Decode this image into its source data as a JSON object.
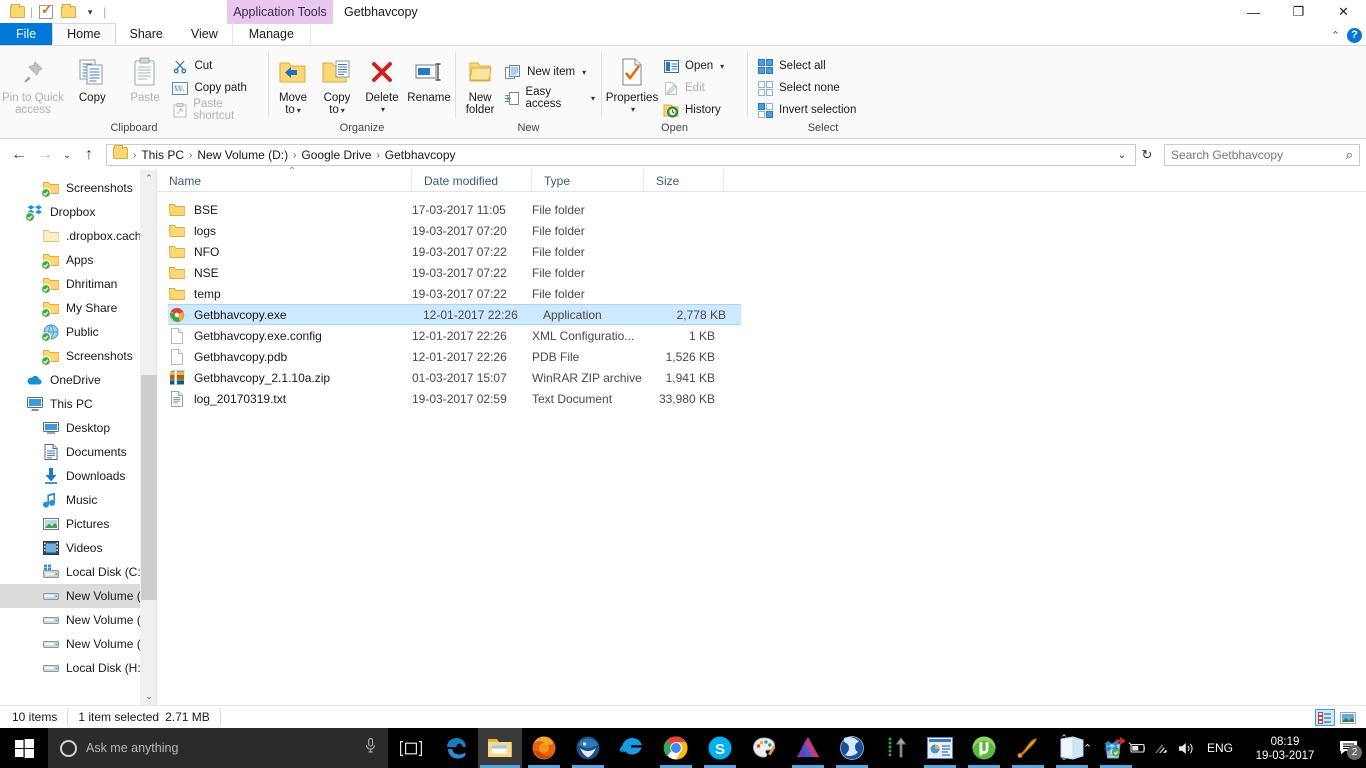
{
  "titlebar": {
    "app_tools_label": "Application Tools",
    "window_title": "Getbhavcopy",
    "minimize": "—",
    "maximize": "❐",
    "close": "✕"
  },
  "tabs": [
    {
      "label": "File",
      "type": "file"
    },
    {
      "label": "Home",
      "type": "active"
    },
    {
      "label": "Share",
      "type": "normal"
    },
    {
      "label": "View",
      "type": "normal"
    },
    {
      "label": "Manage",
      "type": "manage"
    }
  ],
  "ribbon": {
    "groups": [
      {
        "name": "Clipboard",
        "big": [
          {
            "label1": "Pin to Quick",
            "label2": "access",
            "icon": "pin-icon",
            "disabled": true
          },
          {
            "label1": "Copy",
            "label2": "",
            "icon": "copy-icon",
            "disabled": false
          },
          {
            "label1": "Paste",
            "label2": "",
            "icon": "paste-icon",
            "disabled": true
          }
        ],
        "small": [
          {
            "label": "Cut",
            "icon": "scissors-icon",
            "disabled": false
          },
          {
            "label": "Copy path",
            "icon": "copy-path-icon",
            "disabled": false
          },
          {
            "label": "Paste shortcut",
            "icon": "paste-shortcut-icon",
            "disabled": true
          }
        ]
      },
      {
        "name": "Organize",
        "big": [
          {
            "label1": "Move",
            "label2": "to",
            "icon": "move-to-icon",
            "caret": true
          },
          {
            "label1": "Copy",
            "label2": "to",
            "icon": "copy-to-icon",
            "caret": true
          },
          {
            "label1": "Delete",
            "label2": "",
            "icon": "delete-icon",
            "caret": true
          },
          {
            "label1": "Rename",
            "label2": "",
            "icon": "rename-icon",
            "caret": false
          }
        ]
      },
      {
        "name": "New",
        "big": [
          {
            "label1": "New",
            "label2": "folder",
            "icon": "new-folder-icon"
          }
        ],
        "small": [
          {
            "label": "New item",
            "icon": "new-item-icon",
            "caret": true
          },
          {
            "label": "Easy access",
            "icon": "easy-access-icon",
            "caret": true
          }
        ]
      },
      {
        "name": "Open",
        "big": [
          {
            "label1": "Properties",
            "label2": "",
            "icon": "properties-icon",
            "caret": true
          }
        ],
        "small": [
          {
            "label": "Open",
            "icon": "open-icon",
            "caret": true,
            "disabled": false
          },
          {
            "label": "Edit",
            "icon": "edit-icon",
            "disabled": true
          },
          {
            "label": "History",
            "icon": "history-icon",
            "disabled": false
          }
        ]
      },
      {
        "name": "Select",
        "small": [
          {
            "label": "Select all",
            "icon": "select-all-icon"
          },
          {
            "label": "Select none",
            "icon": "select-none-icon"
          },
          {
            "label": "Invert selection",
            "icon": "invert-selection-icon"
          }
        ]
      }
    ]
  },
  "addressbar": {
    "back": "←",
    "forward": "→",
    "recent": "⌄",
    "up": "↑",
    "breadcrumbs": [
      "This PC",
      "New Volume (D:)",
      "Google Drive",
      "Getbhavcopy"
    ],
    "dropdown": "⌄",
    "refresh": "↻",
    "search_placeholder": "Search Getbhavcopy",
    "search_value": "",
    "search_icon": "search-icon"
  },
  "navpane": {
    "items": [
      {
        "label": "Screenshots",
        "level": 1,
        "icon": "folder-sync-icon",
        "selected": false
      },
      {
        "label": "Dropbox",
        "level": 0,
        "icon": "dropbox-icon",
        "selected": false
      },
      {
        "label": ".dropbox.cache",
        "level": 1,
        "icon": "folder-plain-icon",
        "selected": false
      },
      {
        "label": "Apps",
        "level": 1,
        "icon": "folder-sync-icon",
        "selected": false
      },
      {
        "label": "Dhritiman",
        "level": 1,
        "icon": "folder-sync-icon",
        "selected": false
      },
      {
        "label": "My Share",
        "level": 1,
        "icon": "folder-sync-icon",
        "selected": false
      },
      {
        "label": "Public",
        "level": 1,
        "icon": "globe-sync-icon",
        "selected": false
      },
      {
        "label": "Screenshots",
        "level": 1,
        "icon": "folder-sync-icon",
        "selected": false
      },
      {
        "label": "OneDrive",
        "level": 0,
        "icon": "onedrive-icon",
        "selected": false
      },
      {
        "label": "This PC",
        "level": 0,
        "icon": "this-pc-icon",
        "selected": false
      },
      {
        "label": "Desktop",
        "level": 1,
        "icon": "desktop-icon",
        "selected": false
      },
      {
        "label": "Documents",
        "level": 1,
        "icon": "documents-icon",
        "selected": false
      },
      {
        "label": "Downloads",
        "level": 1,
        "icon": "downloads-icon",
        "selected": false
      },
      {
        "label": "Music",
        "level": 1,
        "icon": "music-icon",
        "selected": false
      },
      {
        "label": "Pictures",
        "level": 1,
        "icon": "pictures-icon",
        "selected": false
      },
      {
        "label": "Videos",
        "level": 1,
        "icon": "videos-icon",
        "selected": false
      },
      {
        "label": "Local Disk (C:)",
        "level": 1,
        "icon": "system-drive-icon",
        "selected": false
      },
      {
        "label": "New Volume (D:)",
        "level": 1,
        "icon": "drive-icon",
        "selected": true
      },
      {
        "label": "New Volume (F:)",
        "level": 1,
        "icon": "drive-icon",
        "selected": false
      },
      {
        "label": "New Volume (G:)",
        "level": 1,
        "icon": "drive-icon",
        "selected": false
      },
      {
        "label": "Local Disk (H:)",
        "level": 1,
        "icon": "drive-icon",
        "selected": false
      }
    ],
    "scroll_up": "⌃",
    "scroll_down": "⌄"
  },
  "filelist": {
    "columns": [
      {
        "label": "Name",
        "key": "name"
      },
      {
        "label": "Date modified",
        "key": "date"
      },
      {
        "label": "Type",
        "key": "type"
      },
      {
        "label": "Size",
        "key": "size"
      }
    ],
    "sort_indicator": "⌃",
    "rows": [
      {
        "name": "BSE",
        "date": "17-03-2017 11:05",
        "type": "File folder",
        "size": "",
        "icon": "folder-icon",
        "selected": false
      },
      {
        "name": "logs",
        "date": "19-03-2017 07:20",
        "type": "File folder",
        "size": "",
        "icon": "folder-icon",
        "selected": false
      },
      {
        "name": "NFO",
        "date": "19-03-2017 07:22",
        "type": "File folder",
        "size": "",
        "icon": "folder-icon",
        "selected": false
      },
      {
        "name": "NSE",
        "date": "19-03-2017 07:22",
        "type": "File folder",
        "size": "",
        "icon": "folder-icon",
        "selected": false
      },
      {
        "name": "temp",
        "date": "19-03-2017 07:22",
        "type": "File folder",
        "size": "",
        "icon": "folder-icon",
        "selected": false
      },
      {
        "name": "Getbhavcopy.exe",
        "date": "12-01-2017 22:26",
        "type": "Application",
        "size": "2,778 KB",
        "icon": "app-exe-icon",
        "selected": true
      },
      {
        "name": "Getbhavcopy.exe.config",
        "date": "12-01-2017 22:26",
        "type": "XML Configuratio...",
        "size": "1 KB",
        "icon": "blank-file-icon",
        "selected": false
      },
      {
        "name": "Getbhavcopy.pdb",
        "date": "12-01-2017 22:26",
        "type": "PDB File",
        "size": "1,526 KB",
        "icon": "blank-file-icon",
        "selected": false
      },
      {
        "name": "Getbhavcopy_2.1.10a.zip",
        "date": "01-03-2017 15:07",
        "type": "WinRAR ZIP archive",
        "size": "1,941 KB",
        "icon": "winrar-zip-icon",
        "selected": false
      },
      {
        "name": "log_20170319.txt",
        "date": "19-03-2017 02:59",
        "type": "Text Document",
        "size": "33,980 KB",
        "icon": "text-file-icon",
        "selected": false
      }
    ]
  },
  "statusbar": {
    "item_count": "10 items",
    "selection": "1 item selected",
    "selection_size": "2.71 MB",
    "view_details_icon": "details-view-icon",
    "view_thumbnails_icon": "large-icons-view-icon"
  },
  "taskbar": {
    "start_icon": "windows-start-icon",
    "search_placeholder": "Ask me anything",
    "mic_icon": "microphone-icon",
    "taskview_icon": "task-view-icon",
    "apps": [
      {
        "name": "microsoft-edge-icon",
        "running": false,
        "active": false
      },
      {
        "name": "file-explorer-icon",
        "running": false,
        "active": true
      },
      {
        "name": "firefox-icon",
        "running": true,
        "active": false
      },
      {
        "name": "thunderbird-icon",
        "running": true,
        "active": false
      },
      {
        "name": "internet-explorer-icon",
        "running": false,
        "active": false
      },
      {
        "name": "google-chrome-icon",
        "running": true,
        "active": false
      },
      {
        "name": "skype-icon",
        "running": true,
        "active": false
      },
      {
        "name": "paint-icon",
        "running": false,
        "active": false
      },
      {
        "name": "affinity-designer-icon",
        "running": true,
        "active": false
      },
      {
        "name": "google-earth-icon",
        "running": true,
        "active": false
      },
      {
        "name": "filezilla-icon",
        "running": false,
        "active": false
      },
      {
        "name": "presentation-icon",
        "running": true,
        "active": false
      },
      {
        "name": "utorrent-icon",
        "running": true,
        "active": false
      },
      {
        "name": "putty-icon",
        "running": true,
        "active": false
      },
      {
        "name": "onenote-icon",
        "running": true,
        "active": false
      },
      {
        "name": "recycle-backup-icon",
        "running": true,
        "active": false
      }
    ],
    "tray": {
      "expand_icon": "show-hidden-icons-chevron",
      "dropbox_icon": "dropbox-tray-icon",
      "battery_icon": "battery-icon",
      "wifi_icon": "wifi-icon",
      "volume_icon": "volume-icon",
      "language": "ENG",
      "time": "08:19",
      "date": "19-03-2017",
      "action_center_icon": "action-center-icon",
      "notification_count": "2"
    }
  }
}
